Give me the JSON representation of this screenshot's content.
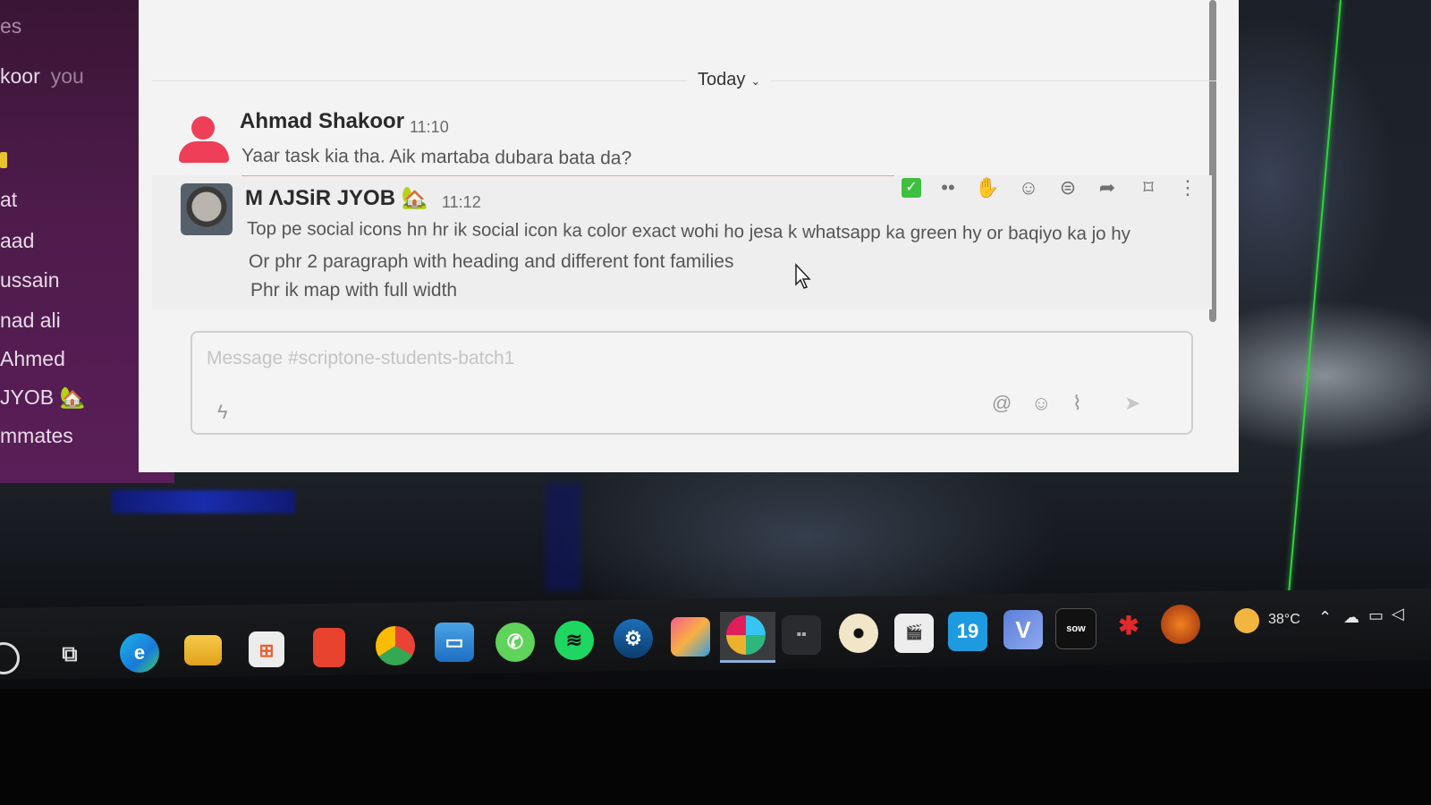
{
  "sidebar": {
    "items": [
      {
        "label": "es",
        "dim": true
      },
      {
        "label": "koor",
        "suffix": "you"
      },
      {
        "label": "at"
      },
      {
        "label": "aad"
      },
      {
        "label": "ussain"
      },
      {
        "label": "nad ali"
      },
      {
        "label": "Ahmed"
      },
      {
        "label": "JYOB 🏡"
      },
      {
        "label": "mmates"
      }
    ]
  },
  "channel": {
    "date_divider": "Today",
    "messages": [
      {
        "author": "Ahmad Shakoor",
        "time": "11:10",
        "lines": [
          "Yaar task kia tha. Aik martaba dubara bata da?"
        ]
      },
      {
        "author": "M ɅJSiR JYOB 🏡",
        "time": "11:12",
        "lines": [
          "Top pe social icons hn hr ik social icon ka color exact wohi ho jesa k whatsapp ka green hy or baqiyo ka jo hy",
          "Or phr 2 paragraph with heading and different font families",
          "Phr ik map with full width"
        ]
      }
    ],
    "message_actions": [
      "check-icon",
      "dots-icon",
      "hands-icon",
      "add-reaction-icon",
      "reply-thread-icon",
      "share-icon",
      "bookmark-icon",
      "more-icon"
    ]
  },
  "composer": {
    "placeholder": "Message #scriptone-students-batch1",
    "icons": [
      "shortcuts-icon",
      "mention-icon",
      "emoji-icon",
      "attach-icon",
      "send-icon"
    ]
  },
  "taskbar": {
    "apps": [
      "search",
      "task-view",
      "edge",
      "file-explorer",
      "store",
      "office",
      "chrome",
      "remote-desktop",
      "whatsapp",
      "spotify",
      "steam",
      "photo-app",
      "slack",
      "terminal",
      "media-player",
      "clapper",
      "19",
      "vectornator",
      "sow",
      "red-app",
      "torch-app"
    ],
    "temperature": "38°C",
    "tile_19": "19",
    "tile_v": "V",
    "tile_sow": "sow"
  },
  "colors": {
    "sidebar": "#4d1b4a",
    "author_avatar": "#ee3e58",
    "check": "#3fbf3f",
    "green_line": "#31d33b"
  }
}
